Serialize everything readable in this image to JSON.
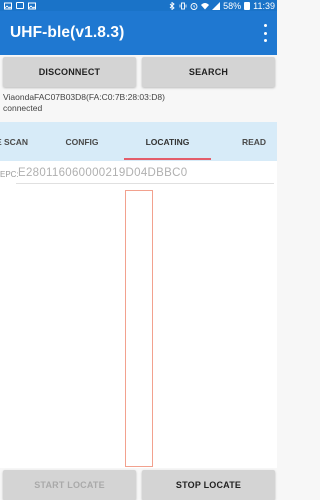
{
  "status_bar": {
    "battery": "58%",
    "time": "11:39",
    "icons_left": [
      "image-icon",
      "notification-box-icon",
      "image-icon"
    ],
    "icons_right": [
      "bluetooth-icon",
      "vibrate-icon",
      "alarm-icon",
      "wifi-icon",
      "signal-icon",
      "battery-icon"
    ]
  },
  "app": {
    "title": "UHF-ble(v1.8.3)",
    "menu_icon": "more-vert-icon"
  },
  "buttons": {
    "disconnect": "DISCONNECT",
    "search": "SEARCH",
    "start_locate": "START LOCATE",
    "stop_locate": "STOP LOCATE"
  },
  "device": {
    "name_address": "ViaondaFAC07B03D8(FA:C0:7B:28:03:D8)",
    "status": "connected"
  },
  "tabs": [
    {
      "label": "E SCAN",
      "active": false
    },
    {
      "label": "CONFIG",
      "active": false
    },
    {
      "label": "LOCATING",
      "active": true
    },
    {
      "label": "READ",
      "active": false
    }
  ],
  "locating": {
    "epc_label": "EPC:",
    "epc_value": "E280116060000219D04DBBC0",
    "signal_level": 0
  },
  "colors": {
    "status_bar": "#1a73c8",
    "app_bar": "#1f78d1",
    "tab_bar": "#d7ebf8",
    "tab_indicator": "#e35d6a",
    "gauge_border": "#f2a18e",
    "button": "#d4d4d4"
  }
}
